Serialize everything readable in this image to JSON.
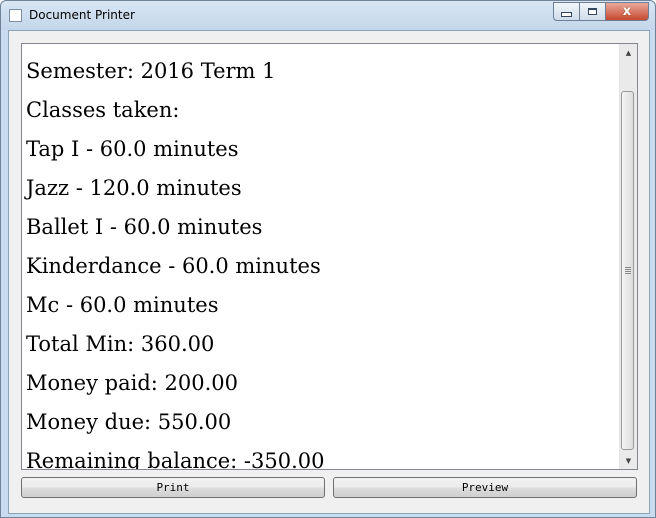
{
  "window": {
    "title": "Document Printer",
    "icon": "app-window-icon"
  },
  "caption_buttons": {
    "minimize_icon": "minimize-icon",
    "maximize_icon": "maximize-icon",
    "close_icon": "close-icon",
    "close_glyph": "x"
  },
  "document": {
    "lines": [
      "Semester: 2016 Term 1",
      "Classes taken:",
      "Tap I - 60.0 minutes",
      "Jazz - 120.0 minutes",
      "Ballet I - 60.0 minutes",
      "Kinderdance - 60.0 minutes",
      "Mc - 60.0 minutes",
      "Total Min: 360.00",
      "Money paid: 200.00",
      "Money due: 550.00",
      "Remaining balance: -350.00"
    ]
  },
  "scrollbar": {
    "up_arrow": "▲",
    "down_arrow": "▼"
  },
  "buttons": {
    "print_label": "Print",
    "preview_label": "Preview"
  },
  "colors": {
    "titlebar": "#c9dbee",
    "close_button": "#c6492f",
    "document_background": "#ffffff",
    "dialog_background": "#f0f0f0"
  }
}
